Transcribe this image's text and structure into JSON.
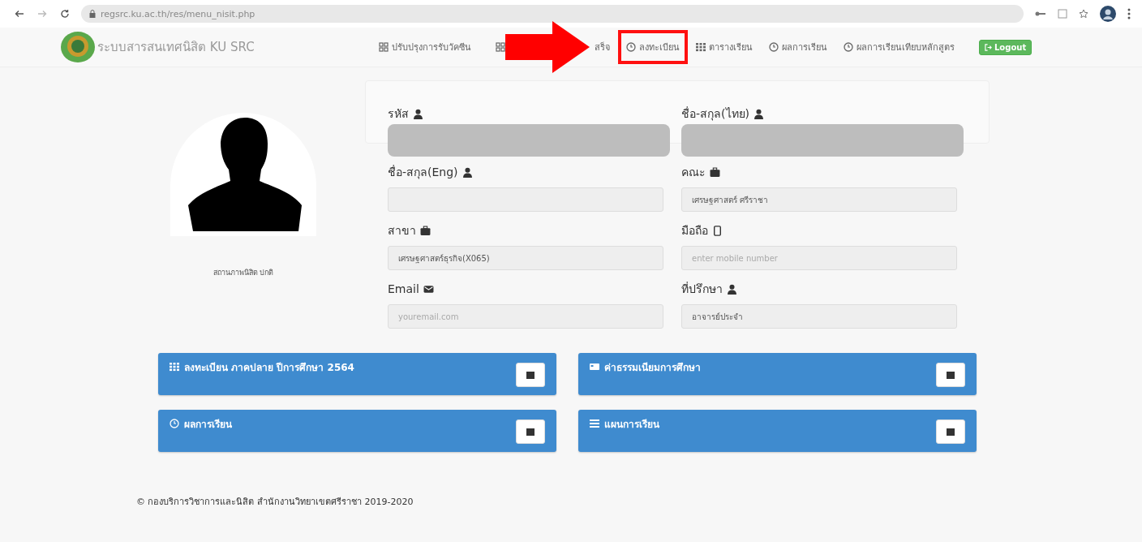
{
  "browser": {
    "url": "regsrc.ku.ac.th/res/menu_nisit.php"
  },
  "navbar": {
    "brand": "ระบบสารสนเทศนิสิต KU SRC",
    "items": [
      {
        "label": "ปรับปรุงการรับวัคซีน",
        "kind": "grid",
        "highlighted": false
      },
      {
        "label": "สร็จ",
        "kind": "grid",
        "highlighted": false
      },
      {
        "label": "ลงทะเบียน",
        "kind": "clock",
        "highlighted": true
      },
      {
        "label": "ตารางเรียน",
        "kind": "table",
        "highlighted": false
      },
      {
        "label": "ผลการเรียน",
        "kind": "clock",
        "highlighted": false
      },
      {
        "label": "ผลการเรียนเทียบหลักสูตร",
        "kind": "clock",
        "highlighted": false
      }
    ],
    "logout": "Logout"
  },
  "profile": {
    "status": "สถานภาพนิสิต ปกติ"
  },
  "fields": [
    {
      "label": "รหัส",
      "kind": "user",
      "redacted": true
    },
    {
      "label": "ชื่อ-สกุล(ไทย)",
      "kind": "user",
      "redacted": true
    },
    {
      "label": "ชื่อ-สกุล(Eng)",
      "kind": "user",
      "redacted": false
    },
    {
      "label": "คณะ",
      "kind": "briefcase",
      "redacted": false,
      "value": "เศรษฐศาสตร์ ศรีราชา"
    },
    {
      "label": "สาขา",
      "kind": "briefcase",
      "redacted": false,
      "value": "เศรษฐศาสตร์ธุรกิจ(X065)"
    },
    {
      "label": "มือถือ",
      "kind": "mobile",
      "redacted": false,
      "placeholder": "enter mobile number"
    },
    {
      "label": "Email",
      "kind": "envelope",
      "redacted": false,
      "placeholder": "youremail.com"
    },
    {
      "label": "ที่ปรึกษา",
      "kind": "user",
      "redacted": false,
      "value": "อาจารย์ประจำ"
    }
  ],
  "cards": [
    {
      "title": "ลงทะเบียน ภาคปลาย ปีการศึกษา 2564",
      "kind": "table"
    },
    {
      "title": "ค่าธรรมเนียมการศึกษา",
      "kind": "card"
    },
    {
      "title": "ผลการเรียน",
      "kind": "clock"
    },
    {
      "title": "แผนการเรียน",
      "kind": "list"
    }
  ],
  "footer": "© กองบริการวิชาการและนิสิต สำนักงานวิทยาเขตศรีราชา 2019-2020"
}
